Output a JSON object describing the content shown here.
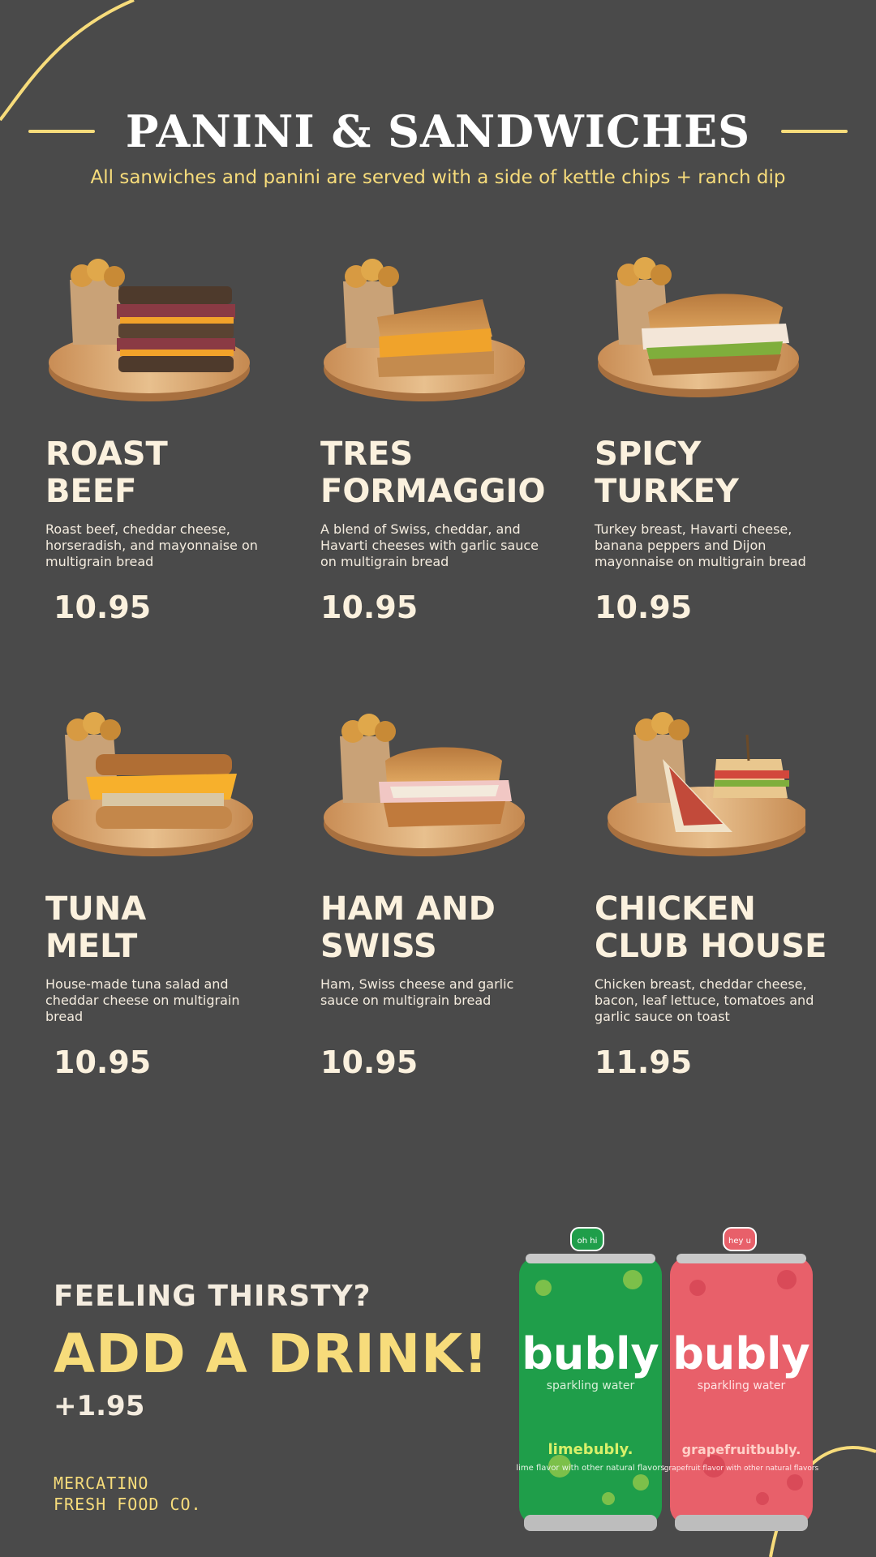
{
  "colors": {
    "background": "#4a4a4a",
    "accent": "#f7dc7b",
    "text": "#fbf1de"
  },
  "header": {
    "title": "PANINI & SANDWICHES",
    "subtitle": "All sanwiches and panini are served with a side of kettle chips + ranch dip"
  },
  "menu": {
    "items": [
      {
        "name": "ROAST\nBEEF",
        "description": "Roast beef, cheddar cheese, horseradish, and mayonnaise on multigrain bread",
        "price": "10.95"
      },
      {
        "name": "TRES\nFORMAGGIO",
        "description": "A blend of Swiss, cheddar, and Havarti cheeses with garlic sauce on multigrain bread",
        "price": "10.95"
      },
      {
        "name": "SPICY\nTURKEY",
        "description": "Turkey breast, Havarti cheese, banana peppers and Dijon mayonnaise on multigrain bread",
        "price": "10.95"
      },
      {
        "name": "TUNA\nMELT",
        "description": "House-made tuna salad and cheddar cheese on multigrain bread",
        "price": "10.95"
      },
      {
        "name": "HAM AND\nSWISS",
        "description": "Ham, Swiss cheese and garlic sauce on multigrain bread",
        "price": "10.95"
      },
      {
        "name": "CHICKEN\nCLUB HOUSE",
        "description": "Chicken breast, cheddar cheese, bacon, leaf lettuce, tomatoes and garlic sauce on toast",
        "price": "11.95"
      }
    ]
  },
  "drinks": {
    "question": "FEELING THIRSTY?",
    "cta": "ADD A DRINK!",
    "price": "+1.95",
    "cans": [
      {
        "cap_text": "oh hi",
        "brand": "bubly",
        "sub": "sparkling water",
        "flavor": "limebubly.",
        "flavor_desc": "lime flavor with other natural flavors",
        "color": "#1f9e4a",
        "dots": "#7cc04a",
        "flavor_color": "#d8f06a"
      },
      {
        "cap_text": "hey u",
        "brand": "bubly",
        "sub": "sparkling water",
        "flavor": "grapefruitbubly.",
        "flavor_desc": "grapefruit flavor with other natural flavors",
        "color": "#e8606a",
        "dots": "#d94a58",
        "flavor_color": "#ffd0c8"
      }
    ]
  },
  "footer": {
    "brand": "MERCATINO\nFRESH FOOD CO."
  }
}
